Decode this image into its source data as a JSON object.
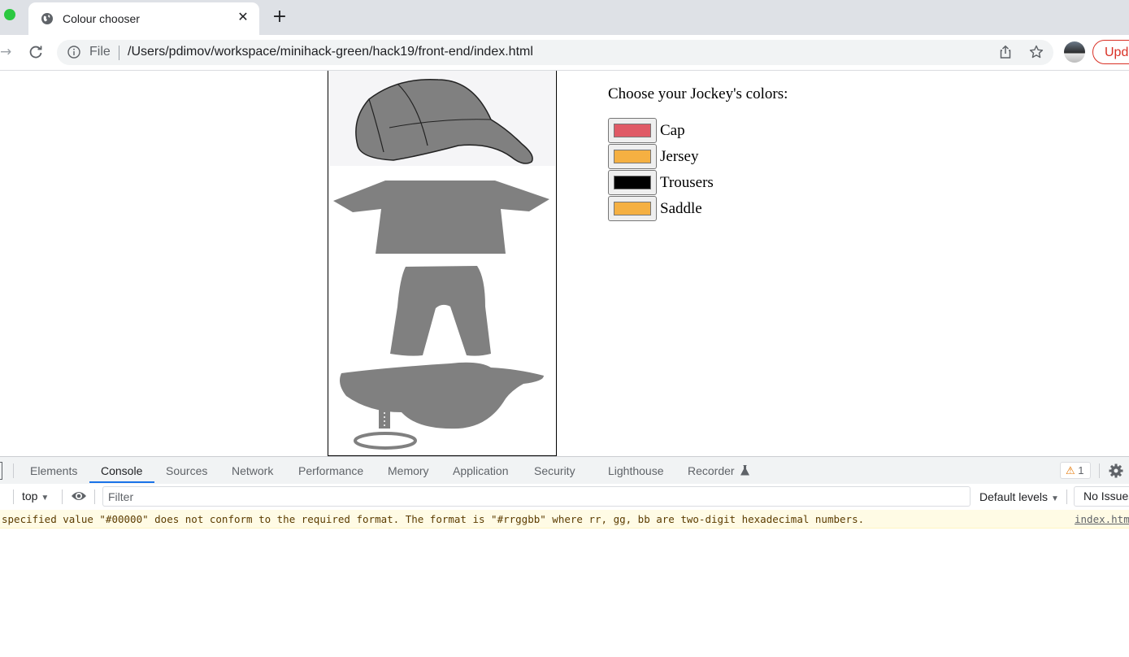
{
  "browser": {
    "tab_title": "Colour chooser",
    "new_tab_symbol": "+",
    "close_symbol": "✕",
    "file_label": "File",
    "url": "/Users/pdimov/workspace/minihack-green/hack19/front-end/index.html",
    "update_label": "Upd"
  },
  "page": {
    "heading": "Choose your Jockey's colors:",
    "pickers": [
      {
        "label": "Cap",
        "color": "#e05a66"
      },
      {
        "label": "Jersey",
        "color": "#f5b042"
      },
      {
        "label": "Trousers",
        "color": "#000000"
      },
      {
        "label": "Saddle",
        "color": "#f5b042"
      }
    ],
    "image_part_color": "#808080"
  },
  "devtools": {
    "tabs": [
      "Elements",
      "Console",
      "Sources",
      "Network",
      "Performance",
      "Memory",
      "Application",
      "Security",
      "Lighthouse",
      "Recorder"
    ],
    "active_tab": "Console",
    "warning_count": "1",
    "context": "top",
    "filter_placeholder": "Filter",
    "levels_label": "Default levels",
    "issues_label": "No Issues",
    "console_message": "specified value \"#00000\" does not conform to the required format.  The format is \"#rrggbb\" where rr, gg, bb are two-digit hexadecimal numbers.",
    "console_source": "index.html"
  }
}
